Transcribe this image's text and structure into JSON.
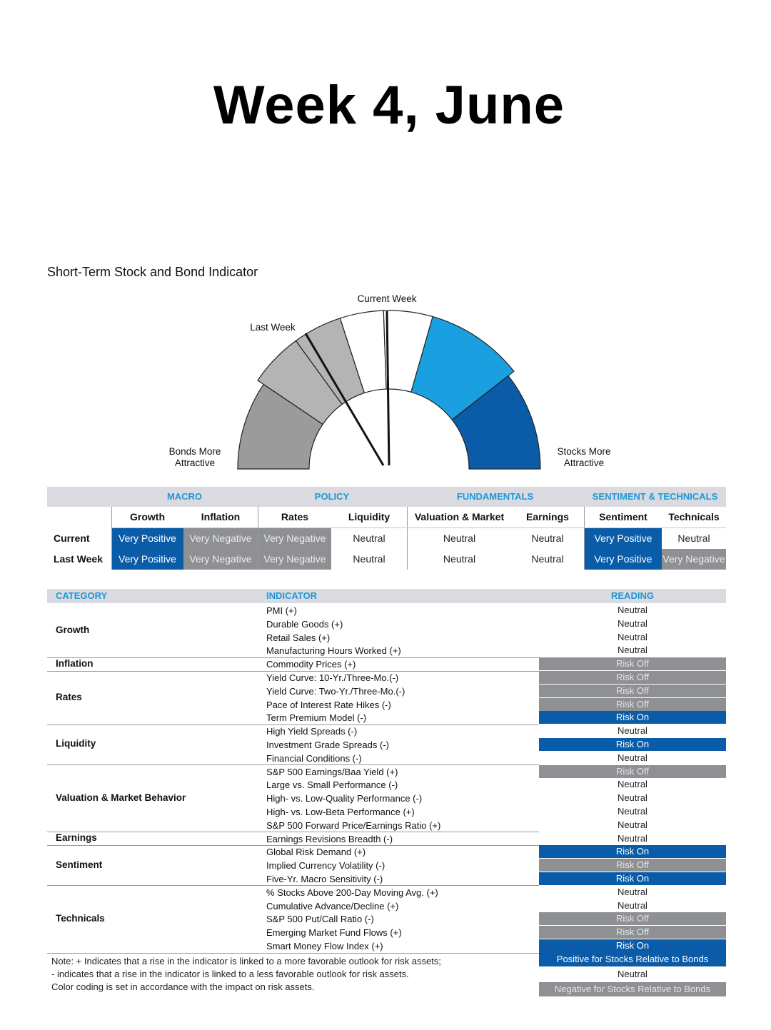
{
  "headline": "Week 4, June",
  "gauge": {
    "title": "Short-Term Stock and Bond Indicator",
    "label_current": "Current Week",
    "label_last": "Last Week",
    "label_bonds": "Bonds More Attractive",
    "label_stocks": "Stocks More Attractive",
    "colors": {
      "gray": "#9b9b9b",
      "light_gray": "#b4b4b4",
      "white": "#ffffff",
      "light_blue": "#1a9fe0",
      "dark_blue": "#0b5ca8"
    }
  },
  "summary": {
    "groups": [
      "MACRO",
      "POLICY",
      "FUNDAMENTALS",
      "SENTIMENT & TECHNICALS"
    ],
    "columns": [
      "Growth",
      "Inflation",
      "Rates",
      "Liquidity",
      "Valuation & Market",
      "Earnings",
      "Sentiment",
      "Technicals"
    ],
    "rows": [
      {
        "label": "Current",
        "values": [
          "Very Positive",
          "Very Negative",
          "Very Negative",
          "Neutral",
          "Neutral",
          "Neutral",
          "Very Positive",
          "Neutral"
        ]
      },
      {
        "label": "Last Week",
        "values": [
          "Very Positive",
          "Very Negative",
          "Very Negative",
          "Neutral",
          "Neutral",
          "Neutral",
          "Very Positive",
          "Very Negative"
        ]
      }
    ]
  },
  "detail": {
    "headers": {
      "category": "CATEGORY",
      "indicator": "INDICATOR",
      "reading": "READING"
    },
    "categories": [
      "Growth",
      "Inflation",
      "Rates",
      "Liquidity",
      "Valuation & Market Behavior",
      "Earnings",
      "Sentiment",
      "Technicals"
    ],
    "rows": [
      {
        "indicator": "PMI (+)",
        "reading": "Neutral"
      },
      {
        "indicator": "Durable Goods (+)",
        "reading": "Neutral"
      },
      {
        "indicator": "Retail Sales (+)",
        "reading": "Neutral"
      },
      {
        "indicator": "Manufacturing Hours Worked (+)",
        "reading": "Neutral"
      },
      {
        "indicator": "Commodity Prices (+)",
        "reading": "Risk Off"
      },
      {
        "indicator": "Yield Curve: 10-Yr./Three-Mo.(-)",
        "reading": "Risk Off"
      },
      {
        "indicator": "Yield Curve: Two-Yr./Three-Mo.(-)",
        "reading": "Risk Off"
      },
      {
        "indicator": "Pace of Interest Rate Hikes (-)",
        "reading": "Risk Off"
      },
      {
        "indicator": "Term Premium Model (-)",
        "reading": "Risk On"
      },
      {
        "indicator": "High Yield Spreads (-)",
        "reading": "Neutral"
      },
      {
        "indicator": "Investment Grade Spreads (-)",
        "reading": "Risk On"
      },
      {
        "indicator": "Financial Conditions (-)",
        "reading": "Neutral"
      },
      {
        "indicator": "S&P 500 Earnings/Baa Yield (+)",
        "reading": "Risk Off"
      },
      {
        "indicator": "Large vs. Small Performance (-)",
        "reading": "Neutral"
      },
      {
        "indicator": "High- vs. Low-Quality Performance (-)",
        "reading": "Neutral"
      },
      {
        "indicator": "High- vs. Low-Beta Performance (+)",
        "reading": "Neutral"
      },
      {
        "indicator": "S&P 500 Forward Price/Earnings Ratio (+)",
        "reading": "Neutral"
      },
      {
        "indicator": "Earnings Revisions Breadth (-)",
        "reading": "Neutral"
      },
      {
        "indicator": "Global Risk Demand (+)",
        "reading": "Risk On"
      },
      {
        "indicator": "Implied Currency Volatility (-)",
        "reading": "Risk Off"
      },
      {
        "indicator": "Five-Yr. Macro Sensitivity (-)",
        "reading": "Risk On"
      },
      {
        "indicator": "% Stocks Above 200-Day Moving Avg. (+)",
        "reading": "Neutral"
      },
      {
        "indicator": "Cumulative Advance/Decline (+)",
        "reading": "Neutral"
      },
      {
        "indicator": "S&P 500 Put/Call Ratio (-)",
        "reading": "Risk Off"
      },
      {
        "indicator": "Emerging Market Fund Flows (+)",
        "reading": "Risk Off"
      },
      {
        "indicator": "Smart Money Flow Index (+)",
        "reading": "Risk On"
      }
    ]
  },
  "notes": {
    "line1": "Note: + Indicates that a rise in the indicator is linked to a more favorable outlook for risk assets;",
    "line2": "- indicates that a rise in the indicator is linked to a less favorable outlook for risk assets.",
    "line3": "Color coding is set in accordance with the impact on risk assets.",
    "legend_positive": "Positive for Stocks Relative to Bonds",
    "legend_neutral": "Neutral",
    "legend_negative": "Negative for Stocks Relative to Bonds"
  }
}
